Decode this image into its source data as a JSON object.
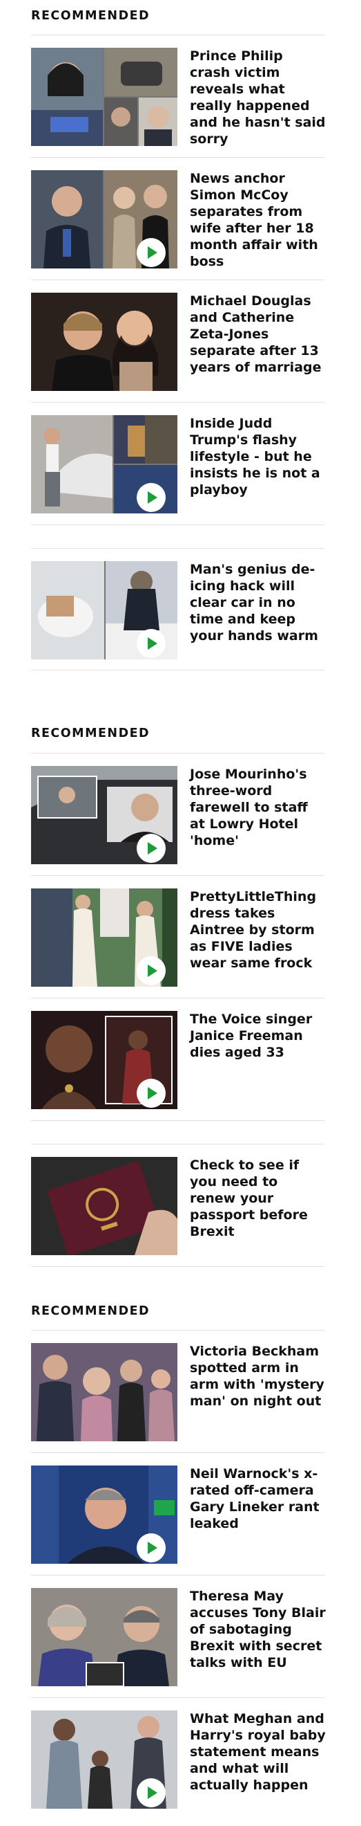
{
  "sections": [
    {
      "label": "RECOMMENDED",
      "articles": [
        {
          "headline": "Prince Philip crash victim reveals what really happened and he hasn't said sorry",
          "video": false
        },
        {
          "headline": "News anchor Simon McCoy separates from wife after her 18 month affair with boss",
          "video": true
        },
        {
          "headline": "Michael Douglas and Catherine Zeta-Jones separate after 13 years of marriage",
          "video": false
        },
        {
          "headline": "Inside Judd Trump's flashy lifestyle - but he insists he is not a playboy",
          "video": true
        },
        {
          "headline": "Man's genius de-icing hack will clear car in no time and keep your hands warm",
          "video": true
        }
      ]
    },
    {
      "label": "RECOMMENDED",
      "articles": [
        {
          "headline": "Jose Mourinho's three-word farewell to staff at Lowry Hotel 'home'",
          "video": true
        },
        {
          "headline": "PrettyLittleThing dress takes Aintree by storm as FIVE ladies wear same frock",
          "video": true
        },
        {
          "headline": "The Voice singer Janice Freeman dies aged 33",
          "video": true
        },
        {
          "headline": "Check to see if you need to renew your passport before Brexit",
          "video": false
        }
      ]
    },
    {
      "label": "RECOMMENDED",
      "articles": [
        {
          "headline": "Victoria Beckham spotted arm in arm with 'mystery man' on night out",
          "video": false
        },
        {
          "headline": "Neil Warnock's x-rated off-camera Gary Lineker rant leaked",
          "video": true
        },
        {
          "headline": "Theresa May accuses Tony Blair of sabotaging Brexit with secret talks with EU",
          "video": false
        },
        {
          "headline": "What Meghan and Harry's royal baby statement means and what will actually happen",
          "video": true
        }
      ]
    }
  ]
}
